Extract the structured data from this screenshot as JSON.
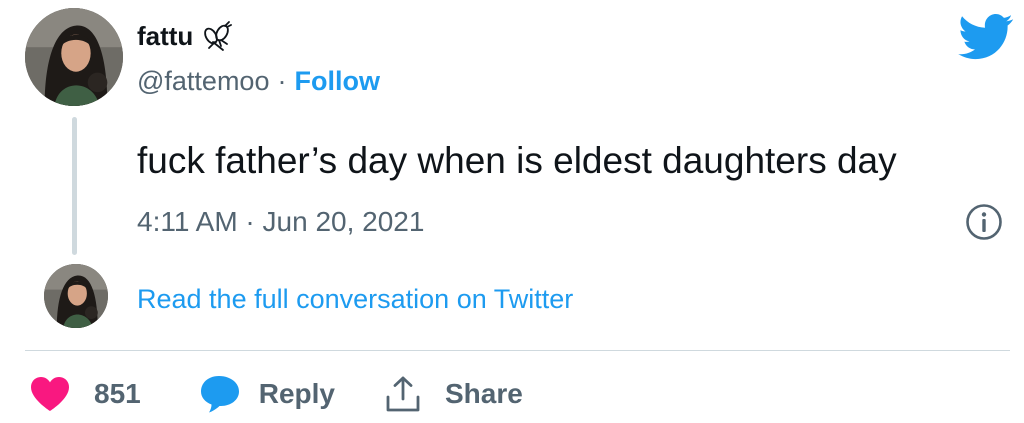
{
  "author": {
    "display_name": "fattu",
    "handle": "@fattemoo",
    "separator": "·",
    "follow_label": "Follow",
    "emoji_icon": "insect-icon"
  },
  "tweet": {
    "text": "fuck father’s day when is eldest daughters day",
    "timestamp": "4:11 AM · Jun 20, 2021"
  },
  "conversation_link": "Read the full conversation on Twitter",
  "actions": {
    "like_count": "851",
    "reply_label": "Reply",
    "share_label": "Share"
  },
  "colors": {
    "accent": "#1d9bf0",
    "like": "#f91880",
    "muted": "#536471",
    "text": "#0f1419",
    "border": "#cfd9de"
  }
}
